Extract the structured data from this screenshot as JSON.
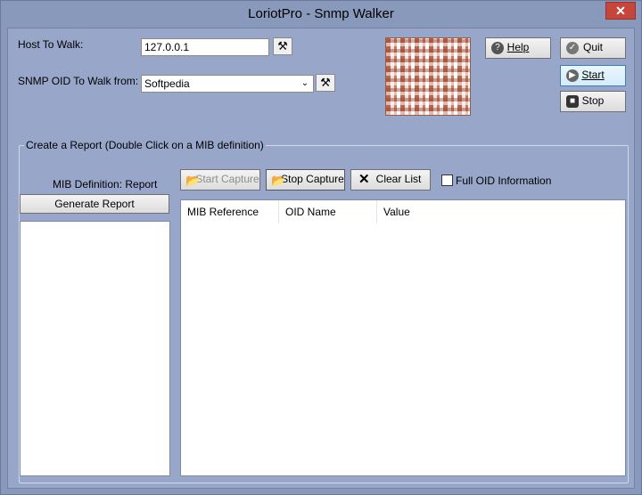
{
  "window": {
    "title": "LoriotPro - Snmp Walker",
    "close_glyph": "✕"
  },
  "form": {
    "host_label": "Host  To Walk:",
    "host_value": "127.0.0.1",
    "oid_label": "SNMP OID To Walk from:",
    "oid_value": "Softpedia"
  },
  "buttons": {
    "help": "Help",
    "quit": "Quit",
    "start": "Start",
    "stop": "Stop",
    "start_capture": "Start Capture",
    "stop_capture": "Stop Capture",
    "clear_list": "Clear List",
    "generate_report": "Generate Report"
  },
  "report": {
    "group_title": "Create a Report  (Double Click on a MIB definition)",
    "mib_definition_label": "MIB Definition: Report",
    "full_oid_label": "Full OID Information",
    "full_oid_checked": false
  },
  "table": {
    "columns": [
      "MIB Reference",
      "OID Name",
      "Value"
    ],
    "rows": []
  },
  "colors": {
    "window_bg": "#8899bb",
    "client_bg": "#98a6c9",
    "close_red": "#c7463b"
  },
  "icons": {
    "help": "question-circle",
    "quit": "check-circle",
    "start": "play-circle",
    "stop": "stop-square",
    "wand": "magic-wand",
    "clear": "x-mark"
  }
}
